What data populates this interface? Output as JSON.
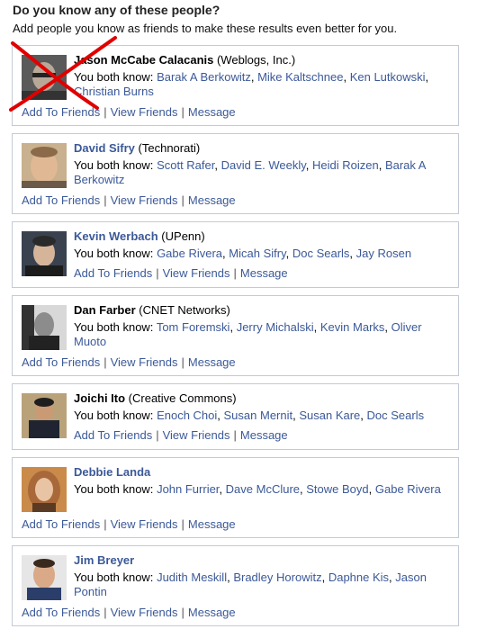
{
  "header": {
    "title": "Do you know any of these people?",
    "subtitle": "Add people you know as friends to make these results even better for you."
  },
  "labels": {
    "you_both_know": "You both know:",
    "add": "Add To Friends",
    "view": "View Friends",
    "message": "Message"
  },
  "people": [
    {
      "name": "Jason McCabe Calacanis",
      "org": " (Weblogs, Inc.)",
      "mutual": [
        "Barak A Berkowitz",
        "Mike Kaltschnee",
        "Ken Lutkowski",
        "Christian Burns"
      ]
    },
    {
      "name": "David Sifry",
      "org": " (Technorati)",
      "mutual": [
        "Scott Rafer",
        "David E. Weekly",
        "Heidi Roizen",
        "Barak A Berkowitz"
      ]
    },
    {
      "name": "Kevin Werbach",
      "org": " (UPenn)",
      "mutual": [
        "Gabe Rivera",
        "Micah Sifry",
        "Doc Searls",
        "Jay Rosen"
      ]
    },
    {
      "name": "Dan Farber",
      "org": " (CNET Networks)",
      "mutual": [
        "Tom Foremski",
        "Jerry Michalski",
        "Kevin Marks",
        "Oliver Muoto"
      ]
    },
    {
      "name": "Joichi Ito",
      "org": " (Creative Commons)",
      "mutual": [
        "Enoch Choi",
        "Susan Mernit",
        "Susan Kare",
        "Doc Searls"
      ]
    },
    {
      "name": "Debbie Landa",
      "org": "",
      "mutual": [
        "John Furrier",
        "Dave McClure",
        "Stowe Boyd",
        "Gabe Rivera"
      ]
    },
    {
      "name": "Jim Breyer",
      "org": "",
      "mutual": [
        "Judith Meskill",
        "Bradley Horowitz",
        "Daphne Kis",
        "Jason Pontin"
      ]
    }
  ],
  "colors": {
    "link": "#3b5998",
    "border": "#c4c9d6",
    "cross": "#e00000"
  }
}
